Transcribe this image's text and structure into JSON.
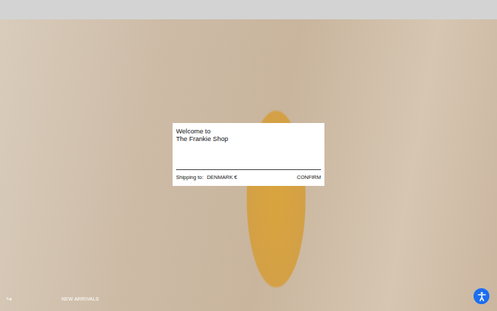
{
  "top_bar": {},
  "welcome": {
    "title_lines": [
      "Welcome to",
      "The Frankie Shop"
    ]
  },
  "shipping": {
    "label": "Shipping to:",
    "value": "DENMARK €"
  },
  "confirm": "CONFIRM",
  "hero": {
    "arrow": "↪",
    "link": "NEW ARRIVALS"
  }
}
